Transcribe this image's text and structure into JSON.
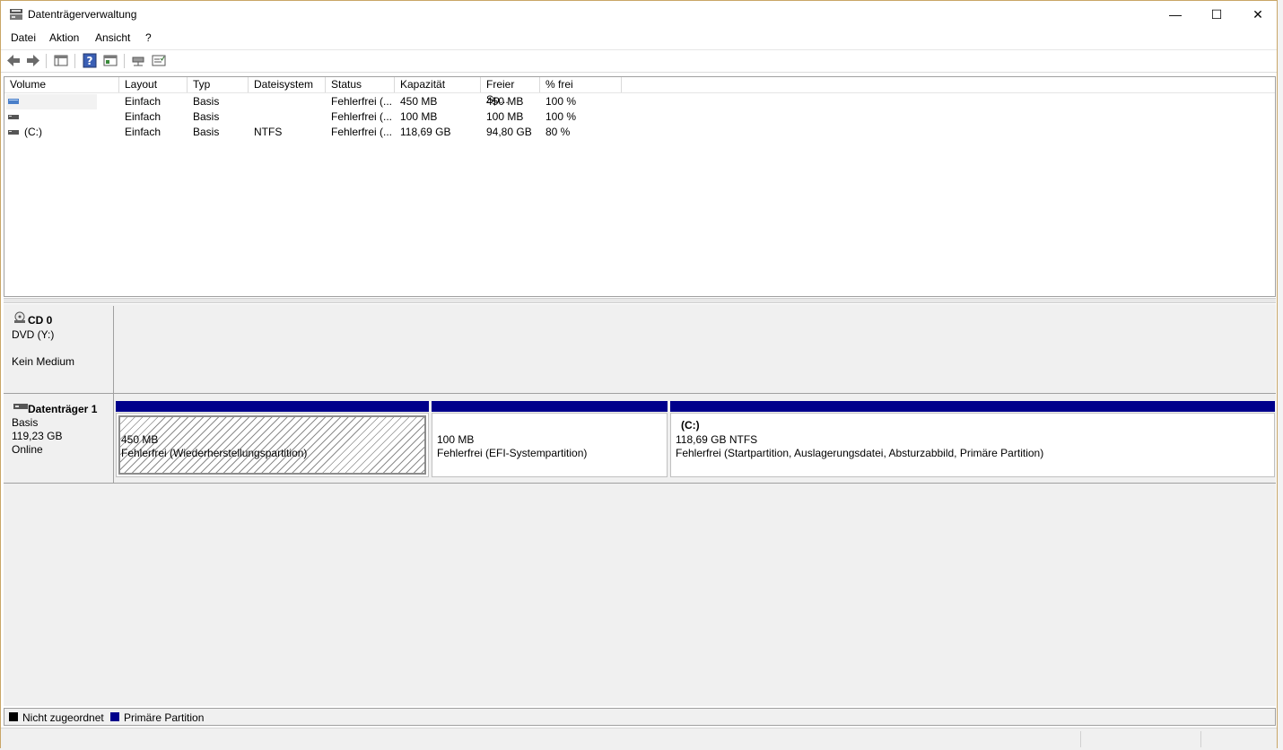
{
  "window": {
    "title": "Datenträgerverwaltung",
    "minimize": "—",
    "maximize": "☐",
    "close": "✕"
  },
  "menu": [
    "Datei",
    "Aktion",
    "Ansicht",
    "?"
  ],
  "toolbar": [
    "back-arrow-icon",
    "forward-arrow-icon",
    "console-tree-icon",
    "help-icon",
    "properties-icon",
    "connect-icon",
    "settings-icon"
  ],
  "volume_list": {
    "columns": [
      "Volume",
      "Layout",
      "Typ",
      "Dateisystem",
      "Status",
      "Kapazität",
      "Freier Sp...",
      "% frei"
    ],
    "rows": [
      {
        "volume": "",
        "layout": "Einfach",
        "typ": "Basis",
        "dateisystem": "",
        "status": "Fehlerfrei (...",
        "kapazitaet": "450 MB",
        "frei": "450 MB",
        "prozent": "100 %"
      },
      {
        "volume": "",
        "layout": "Einfach",
        "typ": "Basis",
        "dateisystem": "",
        "status": "Fehlerfrei (...",
        "kapazitaet": "100 MB",
        "frei": "100 MB",
        "prozent": "100 %"
      },
      {
        "volume": "(C:)",
        "layout": "Einfach",
        "typ": "Basis",
        "dateisystem": "NTFS",
        "status": "Fehlerfrei (...",
        "kapazitaet": "118,69 GB",
        "frei": "94,80 GB",
        "prozent": "80 %"
      }
    ]
  },
  "disks": {
    "cd0": {
      "name": "CD 0",
      "type": "DVD (Y:)",
      "status": "Kein Medium"
    },
    "disk1": {
      "name": "Datenträger 1",
      "type": "Basis",
      "size": "119,23 GB",
      "status": "Online",
      "partitions": [
        {
          "title": "",
          "size": "450 MB",
          "status": "Fehlerfrei (Wiederherstellungspartition)"
        },
        {
          "title": "",
          "size": "100 MB",
          "status": "Fehlerfrei (EFI-Systempartition)"
        },
        {
          "title": "(C:)",
          "size": "118,69 GB NTFS",
          "status": "Fehlerfrei (Startpartition, Auslagerungsdatei, Absturzabbild, Primäre Partition)"
        }
      ]
    }
  },
  "legend": {
    "unallocated": "Nicht zugeordnet",
    "primary": "Primäre Partition",
    "unallocated_color": "#000000",
    "primary_color": "#00008b"
  }
}
